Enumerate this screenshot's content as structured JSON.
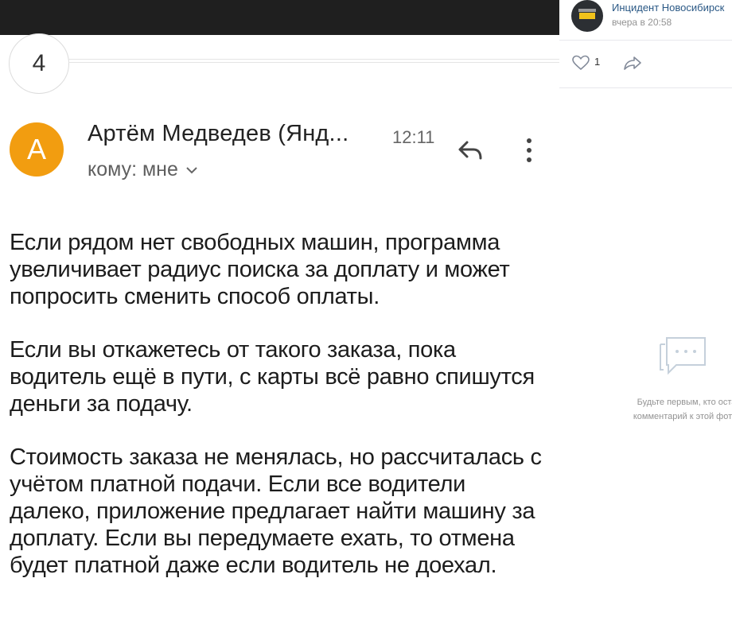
{
  "email": {
    "page_number": "4",
    "avatar_letter": "A",
    "sender": "Артём Медведев (Янд...",
    "time": "12:11",
    "recipient": "кому: мне",
    "paragraphs": [
      "Если рядом нет свободных машин, программа увеличивает радиус поиска за доплату и может попросить сменить способ оплаты.",
      "Если вы откажетесь от такого заказа, пока водитель ещё в пути, с карты всё равно спишутся деньги за подачу.",
      "Стоимость заказа не менялась, но рассчиталась с учётом платной подачи. Если все водители далеко, приложение предлагает найти машину за доплату. Если вы передумаете ехать, то отмена будет платной даже если водитель не доехал."
    ],
    "icons": {
      "reply": "reply-icon",
      "more": "more-vertical-icon",
      "expand": "chevron-down-icon"
    },
    "colors": {
      "avatar": "#f29d10",
      "topbar": "#1f1f1f"
    }
  },
  "sidebar": {
    "group_name": "Инцидент Новосибирск",
    "post_time": "вчера в 20:58",
    "likes": "1",
    "empty_comments_line1": "Будьте первым, кто оста",
    "empty_comments_line2": "комментарий к этой фотог",
    "icons": {
      "like": "heart-icon",
      "share": "share-icon",
      "comments": "comment-bubble-icon"
    },
    "colors": {
      "link": "#2a5885",
      "muted": "#939393"
    }
  }
}
